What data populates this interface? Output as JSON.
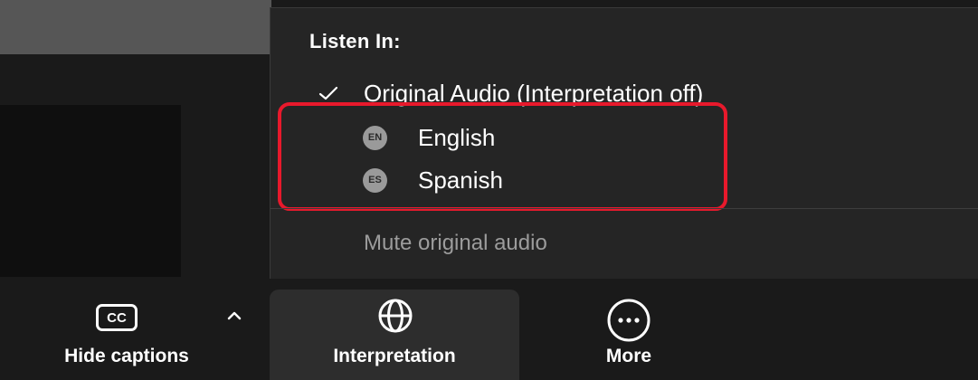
{
  "menu": {
    "title": "Listen In:",
    "original_audio": {
      "label": "Original Audio (Interpretation off)",
      "checked": true,
      "icon": "checkmark-icon"
    },
    "languages": [
      {
        "code": "EN",
        "label": "English"
      },
      {
        "code": "ES",
        "label": "Spanish"
      }
    ],
    "mute_label": "Mute original audio",
    "highlight_color": "#e8192c"
  },
  "toolbar": {
    "captions": {
      "label": "Hide captions",
      "icon": "closed-captions-icon",
      "badge": "CC"
    },
    "interpretation": {
      "label": "Interpretation",
      "icon": "globe-icon",
      "active": true
    },
    "more": {
      "label": "More",
      "icon": "more-icon"
    }
  },
  "colors": {
    "background": "#1a1a1a",
    "menu_background": "#252525",
    "active_tool_background": "#2d2d2d",
    "muted_text": "#9c9c9c",
    "badge": "#9a9a9a"
  }
}
